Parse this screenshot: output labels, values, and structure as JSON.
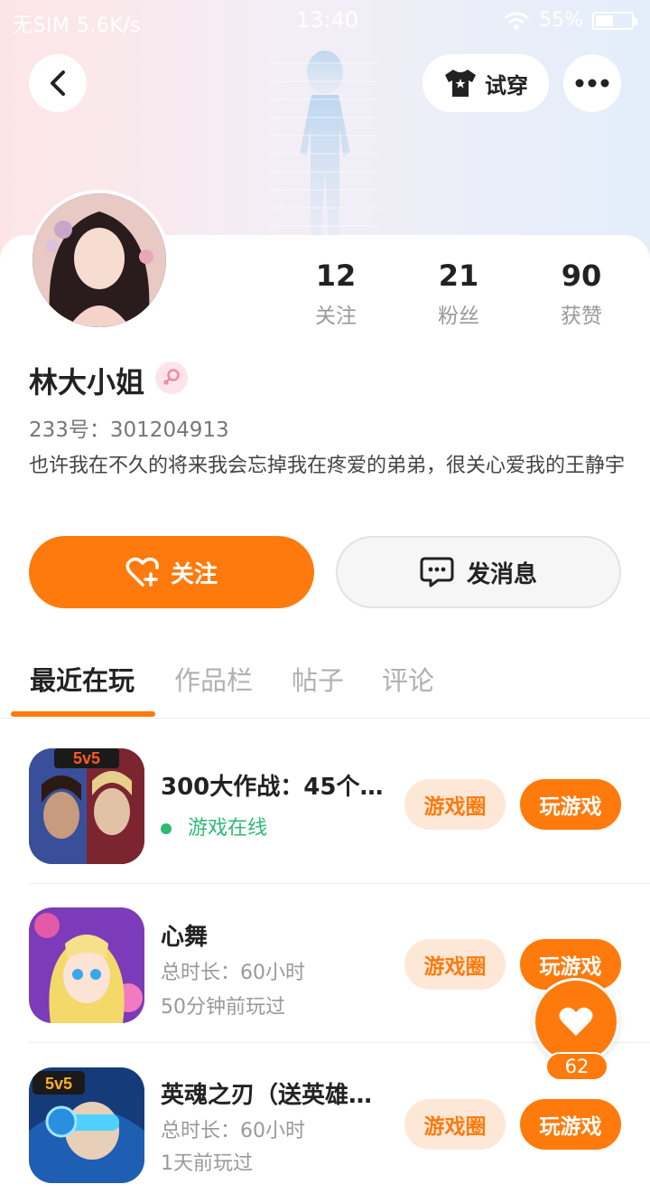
{
  "status_bar": {
    "carrier": "无SIM 5.6K/s",
    "time": "13:40",
    "battery": "55%",
    "battery_level": 0.55
  },
  "header": {
    "tryon_label": "试穿"
  },
  "profile": {
    "name": "林大小姐",
    "id_label": "233号：",
    "id_value": "301204913",
    "bio": "也许我在不久的将来我会忘掉我在疼爱的弟弟，很关心爱我的王静宇",
    "stats": [
      {
        "value": "12",
        "label": "关注"
      },
      {
        "value": "21",
        "label": "粉丝"
      },
      {
        "value": "90",
        "label": "获赞"
      }
    ]
  },
  "actions": {
    "follow_label": "关注",
    "message_label": "发消息"
  },
  "tabs": [
    {
      "label": "最近在玩",
      "active": true
    },
    {
      "label": "作品栏",
      "active": false
    },
    {
      "label": "帖子",
      "active": false
    },
    {
      "label": "评论",
      "active": false
    }
  ],
  "games": [
    {
      "title": "300大作战：45个…",
      "line1": "游戏在线",
      "line2": "",
      "online": true,
      "circle_label": "游戏圈",
      "play_label": "玩游戏"
    },
    {
      "title": "心舞",
      "line1": "总时长：60小时",
      "line2": "50分钟前玩过",
      "online": false,
      "circle_label": "游戏圈",
      "play_label": "玩游戏"
    },
    {
      "title": "英魂之刃（送英雄…",
      "line1": "总时长：60小时",
      "line2": "1天前玩过",
      "online": false,
      "circle_label": "游戏圈",
      "play_label": "玩游戏"
    }
  ],
  "like_fab": {
    "count": "62"
  },
  "colors": {
    "accent": "#ff7a0c",
    "online": "#2dbb70"
  }
}
